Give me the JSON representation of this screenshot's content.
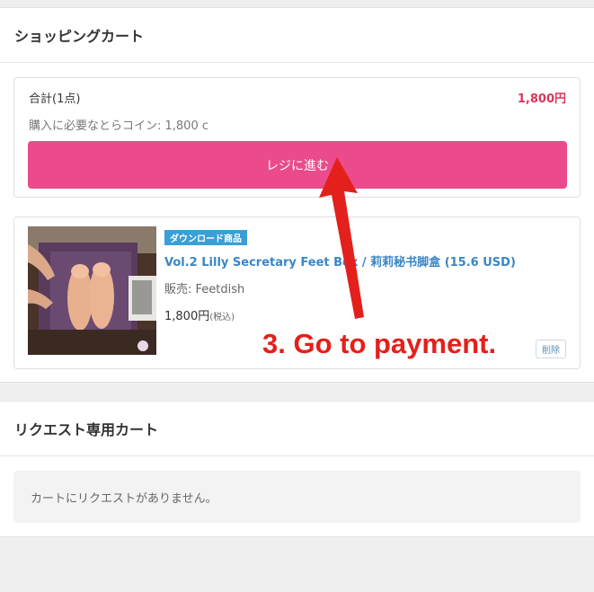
{
  "cart": {
    "title": "ショッピングカート",
    "summary": {
      "total_label": "合計(1点)",
      "total_price": "1,800円",
      "coin_note": "購入に必要なとらコイン: 1,800 c",
      "checkout_label": "レジに進む"
    },
    "item": {
      "badge": "ダウンロード商品",
      "title": "Vol.2 Lilly Secretary Feet Box / 莉莉秘书脚盒 (15.6 USD)",
      "seller": "販売: Feetdish",
      "price": "1,800円",
      "tax": "(税込)",
      "delete_label": "削除"
    }
  },
  "annotation": {
    "text": "3. Go to payment.",
    "color": "#e3201b"
  },
  "request_cart": {
    "title": "リクエスト専用カート",
    "empty_message": "カートにリクエストがありません。"
  },
  "colors": {
    "checkout_button": "#eb4b8a",
    "price_accent": "#d9365a",
    "link": "#3a86c4",
    "badge": "#3a9fd6"
  }
}
